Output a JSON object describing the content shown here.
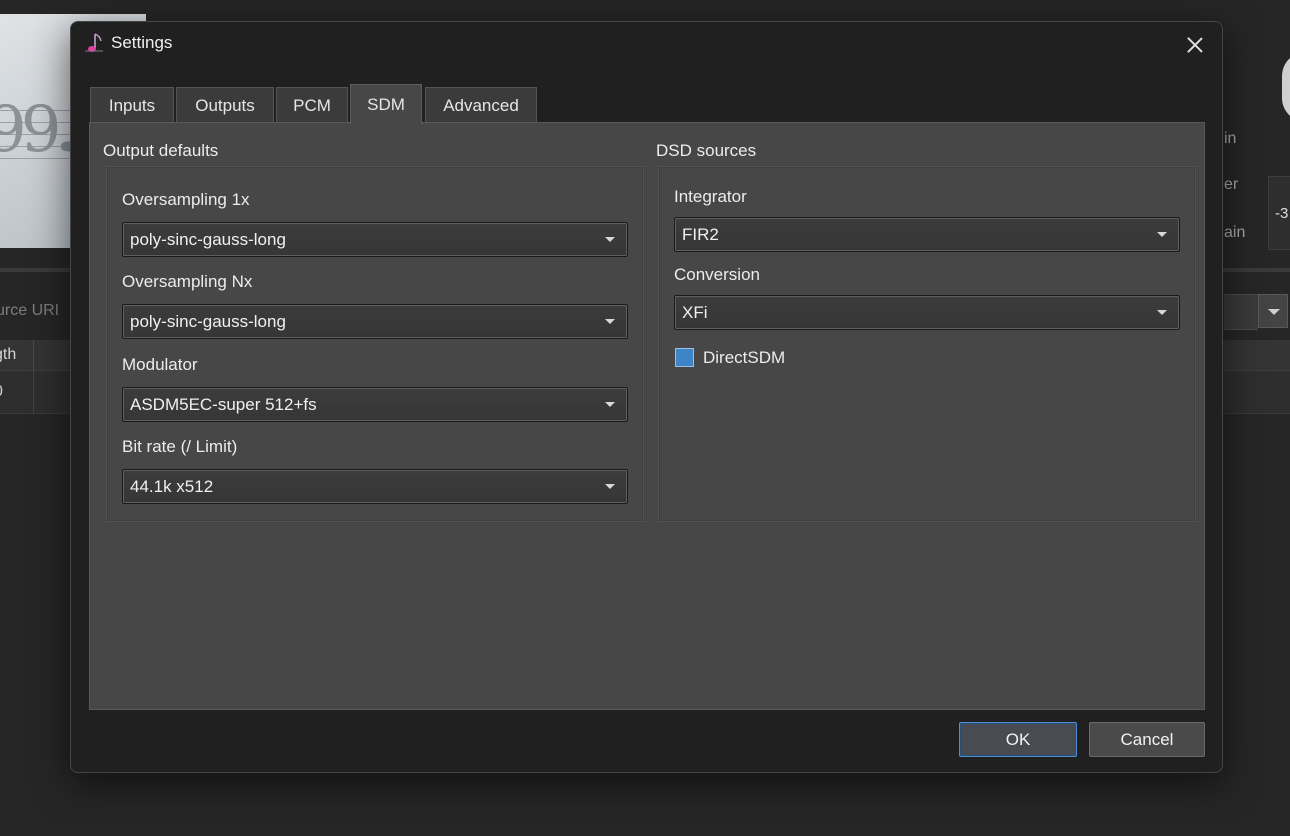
{
  "background": {
    "source_label": "urce URI",
    "column_header": "gth",
    "row_value": "0",
    "right_labels": [
      "in",
      "er",
      "ain"
    ],
    "gain_value": "-3"
  },
  "dialog": {
    "title": "Settings",
    "close_label": "Close"
  },
  "tabs": [
    {
      "label": "Inputs"
    },
    {
      "label": "Outputs"
    },
    {
      "label": "PCM"
    },
    {
      "label": "SDM",
      "active": true
    },
    {
      "label": "Advanced"
    }
  ],
  "output_defaults": {
    "title": "Output defaults",
    "oversampling_1x": {
      "label": "Oversampling 1x",
      "value": "poly-sinc-gauss-long"
    },
    "oversampling_nx": {
      "label": "Oversampling Nx",
      "value": "poly-sinc-gauss-long"
    },
    "modulator": {
      "label": "Modulator",
      "value": "ASDM5EC-super 512+fs"
    },
    "bit_rate": {
      "label": "Bit rate (/ Limit)",
      "value": "44.1k x512"
    }
  },
  "dsd_sources": {
    "title": "DSD sources",
    "integrator": {
      "label": "Integrator",
      "value": "FIR2"
    },
    "conversion": {
      "label": "Conversion",
      "value": "XFi"
    },
    "direct_sdm": {
      "label": "DirectSDM",
      "checked": true
    }
  },
  "footer": {
    "ok_label": "OK",
    "cancel_label": "Cancel"
  },
  "colors": {
    "accent": "#3d85c6",
    "dialog_bg": "#202020",
    "panel_bg": "#474747"
  }
}
